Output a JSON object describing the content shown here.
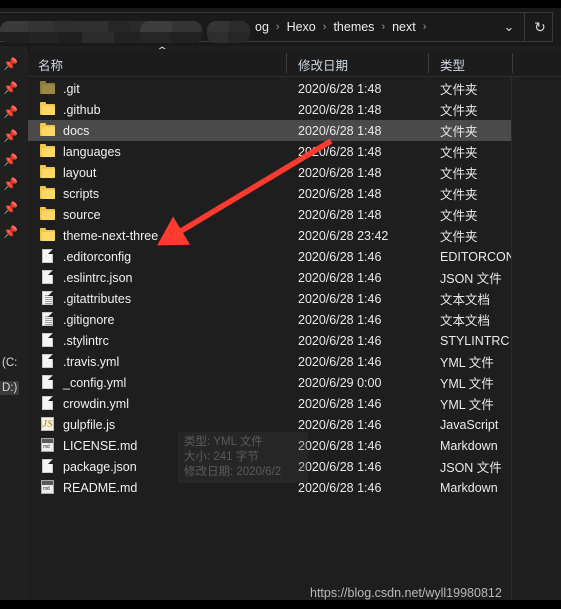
{
  "window": {
    "title_bar_visible": false
  },
  "addressbar": {
    "crumbs": [
      "og",
      "Hexo",
      "themes",
      "next"
    ],
    "separator": "›",
    "redacted": true,
    "dropdown_icon": "chevron-down-icon",
    "refresh_icon": "refresh-icon",
    "refresh_glyph": "↻",
    "chevron_glyph": "⌄"
  },
  "columns": {
    "name": "名称",
    "date": "修改日期",
    "type": "类型",
    "sort_caret": "⌃"
  },
  "nav": {
    "pin_glyph": "📌",
    "pin_count": 8,
    "drives": [
      {
        "label": "(C:",
        "selected": false
      },
      {
        "label": "D:)",
        "selected": true
      }
    ]
  },
  "files": [
    {
      "name": ".git",
      "date": "2020/6/28 1:48",
      "type": "文件夹",
      "icon": "folder-hidden-icon",
      "selected": false
    },
    {
      "name": ".github",
      "date": "2020/6/28 1:48",
      "type": "文件夹",
      "icon": "folder-icon",
      "selected": false
    },
    {
      "name": "docs",
      "date": "2020/6/28 1:48",
      "type": "文件夹",
      "icon": "folder-icon",
      "selected": true
    },
    {
      "name": "languages",
      "date": "2020/6/28 1:48",
      "type": "文件夹",
      "icon": "folder-icon",
      "selected": false
    },
    {
      "name": "layout",
      "date": "2020/6/28 1:48",
      "type": "文件夹",
      "icon": "folder-icon",
      "selected": false
    },
    {
      "name": "scripts",
      "date": "2020/6/28 1:48",
      "type": "文件夹",
      "icon": "folder-icon",
      "selected": false
    },
    {
      "name": "source",
      "date": "2020/6/28 1:48",
      "type": "文件夹",
      "icon": "folder-icon",
      "selected": false
    },
    {
      "name": "theme-next-three",
      "date": "2020/6/28 23:42",
      "type": "文件夹",
      "icon": "folder-icon",
      "selected": false
    },
    {
      "name": ".editorconfig",
      "date": "2020/6/28 1:46",
      "type": "EDITORCON",
      "icon": "file-icon",
      "selected": false
    },
    {
      "name": ".eslintrc.json",
      "date": "2020/6/28 1:46",
      "type": "JSON 文件",
      "icon": "file-icon",
      "selected": false
    },
    {
      "name": ".gitattributes",
      "date": "2020/6/28 1:46",
      "type": "文本文档",
      "icon": "text-file-icon",
      "selected": false
    },
    {
      "name": ".gitignore",
      "date": "2020/6/28 1:46",
      "type": "文本文档",
      "icon": "text-file-icon",
      "selected": false
    },
    {
      "name": ".stylintrc",
      "date": "2020/6/28 1:46",
      "type": "STYLINTRC",
      "icon": "file-icon",
      "selected": false
    },
    {
      "name": ".travis.yml",
      "date": "2020/6/28 1:46",
      "type": "YML 文件",
      "icon": "file-icon",
      "selected": false
    },
    {
      "name": "_config.yml",
      "date": "2020/6/29 0:00",
      "type": "YML 文件",
      "icon": "file-icon",
      "selected": false
    },
    {
      "name": "crowdin.yml",
      "date": "2020/6/28 1:46",
      "type": "YML 文件",
      "icon": "file-icon",
      "selected": false
    },
    {
      "name": "gulpfile.js",
      "date": "2020/6/28 1:46",
      "type": "JavaScript ",
      "icon": "javascript-file-icon",
      "selected": false
    },
    {
      "name": "LICENSE.md",
      "date": "2020/6/28 1:46",
      "type": "Markdown",
      "icon": "markdown-file-icon",
      "selected": false
    },
    {
      "name": "package.json",
      "date": "2020/6/28 1:46",
      "type": "JSON 文件",
      "icon": "file-icon",
      "selected": false
    },
    {
      "name": "README.md",
      "date": "2020/6/28 1:46",
      "type": "Markdown",
      "icon": "markdown-file-icon",
      "selected": false
    }
  ],
  "tooltip": {
    "line1": "类型: YML 文件",
    "line2": "大小: 241 字节",
    "line3": "修改日期: 2020/6/2"
  },
  "annotation": {
    "arrow_color": "#ff3b30",
    "points_to": "theme-next-three"
  },
  "watermark": {
    "text": "https://blog.csdn.net/wyll19980812"
  }
}
